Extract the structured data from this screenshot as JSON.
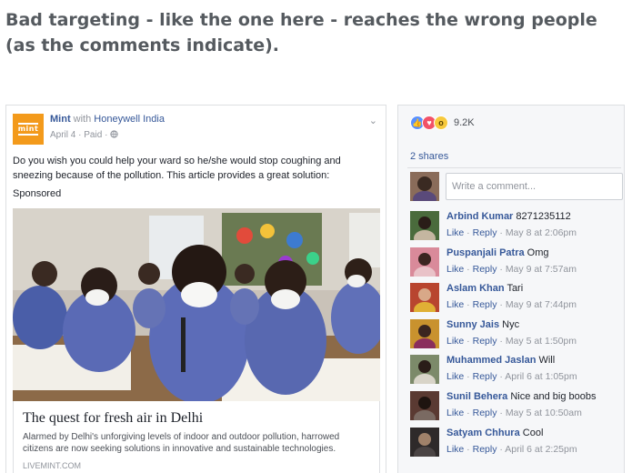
{
  "headline": "Bad targeting - like the one here - reaches the wrong people (as the comments indicate).",
  "post": {
    "logo_text": "mint",
    "page_name": "Mint",
    "with_text": "with",
    "partner": "Honeywell India",
    "date": "April 4",
    "paid": "Paid",
    "separator": "·",
    "globe_icon": "globe-icon",
    "body": "Do you wish you could help your ward so he/she would stop coughing and sneezing because of the pollution. This article provides a great solution:",
    "sponsored": "Sponsored",
    "link": {
      "title": "The quest for fresh air in Delhi",
      "description": "Alarmed by Delhi's unforgiving levels of indoor and outdoor pollution, harrowed citizens are now seeking solutions in innovative and sustainable technologies.",
      "domain": "LIVEMINT.COM"
    }
  },
  "panel": {
    "reaction_count": "9.2K",
    "shares": "2 shares",
    "comment_placeholder": "Write a comment...",
    "like_label": "Like",
    "reply_label": "Reply",
    "comments": [
      {
        "name": "Arbind Kumar",
        "text": "8271235112",
        "time": "May 8 at 2:06pm",
        "color": "#4a6b3c"
      },
      {
        "name": "Puspanjali Patra",
        "text": "Omg",
        "time": "May 9 at 7:57am",
        "color": "#d98a9a"
      },
      {
        "name": "Aslam Khan",
        "text": "Tari",
        "time": "May 9 at 7:44pm",
        "color": "#b8452f"
      },
      {
        "name": "Sunny Jais",
        "text": "Nyc",
        "time": "May 5 at 1:50pm",
        "color": "#c9922e"
      },
      {
        "name": "Muhammed Jaslan",
        "text": "Will",
        "time": "April 6 at 1:05pm",
        "color": "#7c8a6a"
      },
      {
        "name": "Sunil Behera",
        "text": "Nice and big boobs",
        "time": "May 5 at 10:50am",
        "color": "#5a3a32"
      },
      {
        "name": "Satyam Chhura",
        "text": "Cool",
        "time": "April 6 at 2:25pm",
        "color": "#2e2a2a"
      }
    ]
  }
}
